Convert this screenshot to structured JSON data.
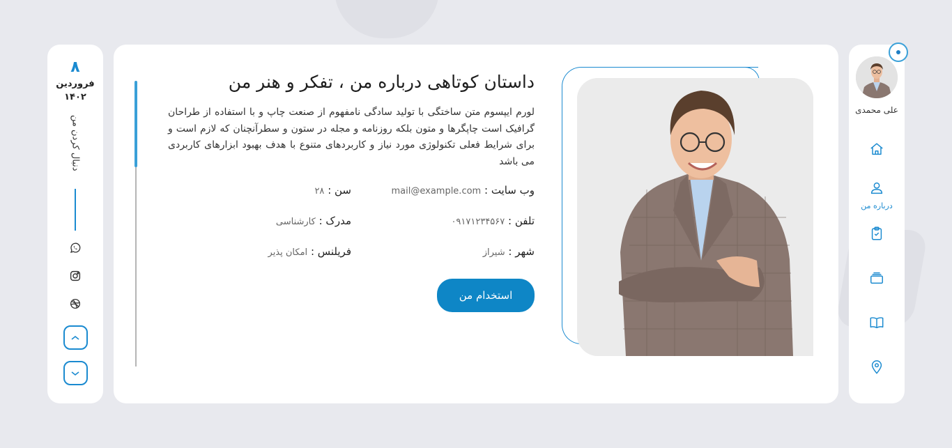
{
  "profile": {
    "name": "علی محمدی"
  },
  "nav": {
    "items": [
      {
        "icon": "home-icon",
        "label": ""
      },
      {
        "icon": "user-icon",
        "label": "درباره من"
      },
      {
        "icon": "clipboard-icon",
        "label": ""
      },
      {
        "icon": "briefcase-icon",
        "label": ""
      },
      {
        "icon": "book-icon",
        "label": ""
      },
      {
        "icon": "location-icon",
        "label": ""
      }
    ]
  },
  "about": {
    "title": "داستان کوتاهی درباره من ، تفکر و هنر من",
    "description": "لورم ایپسوم متن ساختگی با تولید سادگی نامفهوم از صنعت چاپ و با استفاده از طراحان گرافیک است چاپگرها و متون بلکه روزنامه و مجله در ستون و سطرآنچنان که لازم است و برای شرایط فعلی تکنولوژی مورد نیاز و کاربردهای متنوع با هدف بهبود ابزارهای کاربردی می باشد",
    "info": {
      "website_label": "وب سایت :",
      "website_value": "mail@example.com",
      "age_label": "سن :",
      "age_value": "۲۸",
      "phone_label": "تلفن :",
      "phone_value": "۰۹۱۷۱۲۳۴۵۶۷",
      "degree_label": "مدرک :",
      "degree_value": "کارشناسی",
      "city_label": "شهر :",
      "city_value": "شیراز",
      "freelance_label": "فریلنس :",
      "freelance_value": "امکان پذیر"
    },
    "hire_button": "استخدام من"
  },
  "sidebar_left": {
    "day": "۸",
    "month": "فروردین",
    "year": "۱۴۰۲",
    "follow_text": "دنبال کردن من",
    "social_icons": [
      "whatsapp-icon",
      "instagram-icon",
      "dribbble-icon"
    ]
  },
  "colors": {
    "accent": "#1a8ad0",
    "button": "#0e86c6",
    "background": "#e8e9ee"
  }
}
